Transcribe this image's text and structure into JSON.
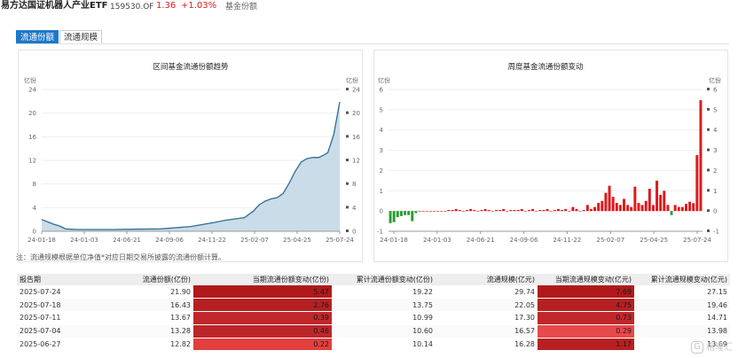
{
  "header": {
    "fund_name": "易方达国证机器人产业ETF",
    "fund_code": "159530.OF",
    "price": "1.36",
    "change": "+1.03%",
    "section": "基金份额"
  },
  "tabs": [
    {
      "label": "流通份额",
      "active": true
    },
    {
      "label": "流通规模",
      "active": false
    }
  ],
  "note": "注：流通规模根据单位净值*对应日期交易所披露的流通份额计算。",
  "colors": {
    "accent": "#1e78c8",
    "area_fill": "#c9dce8",
    "area_line": "#2b6e96",
    "bar_pos": "#e0191c",
    "bar_neg": "#2e9c34"
  },
  "chart_data": [
    {
      "type": "area",
      "title": "区间基金流通份额趋势",
      "unit": "亿份",
      "ylim": [
        0,
        24
      ],
      "yticks": [
        0,
        4,
        8,
        12,
        16,
        20,
        24
      ],
      "xtick_labels": [
        "24-01-18",
        "24-01-03",
        "24-06-21",
        "24-09-06",
        "24-11-22",
        "25-02-07",
        "25-04-25",
        "25-07-24"
      ],
      "x": [
        0,
        2,
        4,
        6,
        8,
        10,
        12,
        14,
        18,
        24,
        30,
        40,
        50,
        58,
        62,
        65,
        68,
        71,
        73,
        75,
        77,
        79,
        81,
        83,
        85,
        87,
        89,
        91,
        93,
        95,
        96,
        98,
        100
      ],
      "values": [
        2.0,
        1.6,
        1.2,
        0.9,
        0.4,
        0.35,
        0.3,
        0.3,
        0.3,
        0.3,
        0.35,
        0.4,
        0.8,
        1.5,
        1.9,
        2.1,
        2.3,
        3.4,
        4.5,
        5.1,
        5.5,
        5.7,
        6.4,
        8.1,
        10.1,
        11.7,
        12.3,
        12.5,
        12.5,
        13.0,
        13.3,
        16.4,
        21.9
      ]
    },
    {
      "type": "bar",
      "title": "周度基金流通份额变动",
      "unit": "亿份",
      "ylim": [
        -1,
        6
      ],
      "yticks": [
        -1,
        0,
        1,
        2,
        3,
        4,
        5,
        6
      ],
      "xtick_labels": [
        "24-01-18",
        "24-01-03",
        "24-06-21",
        "24-09-06",
        "24-11-22",
        "25-02-07",
        "25-04-25",
        "25-07-24"
      ],
      "values": [
        -0.6,
        -0.55,
        -0.3,
        -0.25,
        -0.2,
        -0.2,
        -0.5,
        -0.1,
        0.0,
        0.0,
        0.0,
        0.0,
        0.0,
        0.0,
        0.0,
        0.0,
        0.05,
        0.05,
        0.1,
        0.05,
        0.0,
        0.05,
        0.1,
        0.05,
        0.0,
        0.05,
        0.1,
        0.05,
        0.0,
        0.05,
        0.05,
        0.1,
        0.0,
        0.05,
        0.05,
        0.05,
        0.1,
        0.0,
        0.05,
        0.1,
        0.0,
        0.05,
        0.05,
        0.1,
        0.0,
        0.05,
        0.1,
        0.05,
        0.1,
        0.0,
        0.2,
        0.1,
        0.0,
        0.05,
        0.3,
        0.1,
        0.2,
        0.4,
        0.5,
        0.9,
        1.25,
        0.7,
        0.4,
        0.3,
        0.6,
        0.3,
        0.2,
        1.2,
        0.4,
        0.3,
        0.5,
        1.1,
        0.3,
        1.5,
        0.8,
        1.0,
        0.3,
        -0.2,
        0.3,
        0.2,
        0.2,
        0.35,
        0.46,
        0.39,
        2.76,
        5.47
      ]
    }
  ],
  "table": {
    "headers": [
      "报告期",
      "流通份额(亿份)",
      "当期流通份额变动(亿份)",
      "累计流通份额变动(亿份)",
      "流通规模(亿元)",
      "当期流通规模变动(亿元)",
      "累计流通规模变动(亿元)"
    ],
    "rows": [
      [
        "2025-07-24",
        "21.90",
        "5.47",
        "19.22",
        "29.74",
        "7.69",
        "27.15"
      ],
      [
        "2025-07-18",
        "16.43",
        "2.76",
        "13.75",
        "22.05",
        "4.75",
        "19.46"
      ],
      [
        "2025-07-11",
        "13.67",
        "0.39",
        "10.99",
        "17.30",
        "0.73",
        "14.71"
      ],
      [
        "2025-07-04",
        "13.28",
        "0.46",
        "10.60",
        "16.57",
        "0.29",
        "13.98"
      ],
      [
        "2025-06-27",
        "12.82",
        "0.22",
        "10.14",
        "16.28",
        "1.17",
        "13.69"
      ]
    ],
    "heat": [
      [
        "",
        "",
        "#b2191b",
        "",
        "",
        "#b2191b",
        ""
      ],
      [
        "",
        "",
        "#b52022",
        "",
        "",
        "#b52022",
        ""
      ],
      [
        "",
        "",
        "#c0272b",
        "",
        "",
        "#c0272b",
        ""
      ],
      [
        "",
        "",
        "#bd2629",
        "",
        "",
        "#e8494a",
        ""
      ],
      [
        "",
        "",
        "#e43e3f",
        "",
        "",
        "#b72023",
        ""
      ]
    ]
  },
  "watermark": "格隆汇"
}
